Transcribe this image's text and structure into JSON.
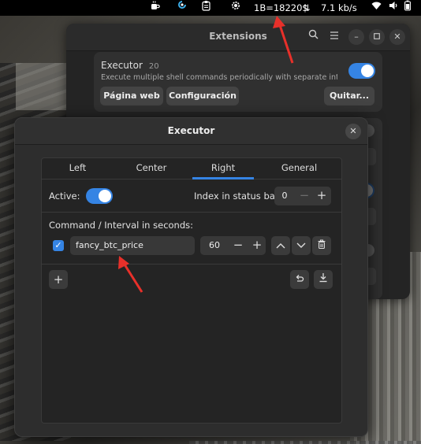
{
  "topbar": {
    "btc_label": "1B=18220$",
    "net_arrows": "⇅",
    "net_speed": "7.1 kb/s"
  },
  "extensions": {
    "title": "Extensions",
    "name": "Executor",
    "version": "20",
    "description": "Execute multiple shell commands periodically with separate intervals and displa...",
    "web_button": "Página web",
    "config_button": "Configuración",
    "remove_button": "Quitar..."
  },
  "dialog": {
    "title": "Executor",
    "tabs": [
      "Left",
      "Center",
      "Right",
      "General"
    ],
    "active_tab": "Right",
    "active_label": "Active:",
    "index_label": "Index in status bar:",
    "index_value": "0",
    "command_header": "Command / Interval in seconds:",
    "command": "fancy_btc_price",
    "interval": "60"
  },
  "icons": {
    "topbar": [
      "coffee-icon",
      "app-icon",
      "clipboard-icon",
      "gear-icon",
      "wifi-icon",
      "volume-icon",
      "battery-icon"
    ],
    "accent": "#3584e4",
    "annotation_arrow_color": "#e8302a"
  }
}
